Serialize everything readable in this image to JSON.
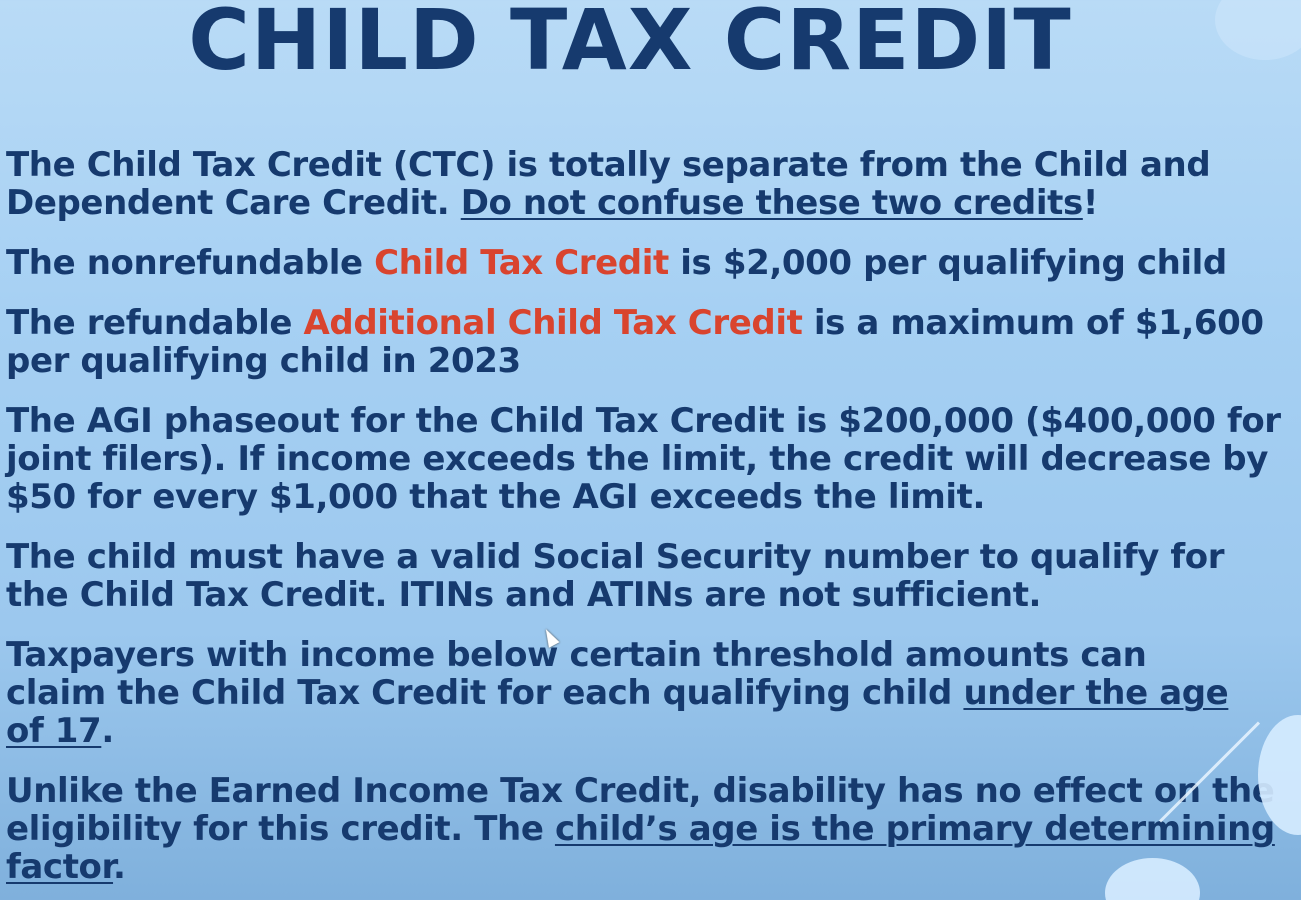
{
  "slide": {
    "title": "CHILD TAX CREDIT",
    "paragraphs": {
      "p1": {
        "a": "The Child Tax Credit (CTC) is totally separate from the Child and",
        "b": "Dependent Care Credit. ",
        "c": "Do not confuse these two credits",
        "d": "!"
      },
      "p2": {
        "a": "The nonrefundable ",
        "b": "Child Tax Credit",
        "c": " is $2,000 per qualifying child"
      },
      "p3": {
        "a": "The refundable ",
        "b": "Additional Child Tax Credit",
        "c": " is a maximum of $1,600",
        "d": "per qualifying child in 2023"
      },
      "p4": {
        "a": "The AGI phaseout for the Child Tax Credit is $200,000 ($400,000 for",
        "b": "joint filers). If income exceeds the limit, the credit will decrease by",
        "c": "$50 for every $1,000 that the AGI exceeds the limit."
      },
      "p5": {
        "a": "The child must have a valid Social Security number to qualify for",
        "b": "the Child Tax Credit. ITINs and ATINs are not sufficient."
      },
      "p6": {
        "a": "Taxpayers with income below certain threshold amounts can",
        "b": "claim the Child Tax Credit for each qualifying child ",
        "c": "under the age",
        "d": "of 17",
        "e": "."
      },
      "p7": {
        "a": "Unlike the Earned Income Tax Credit, disability has no effect on the",
        "b": "eligibility for this credit. The ",
        "c": "child’s age is the primary determining",
        "d": "factor",
        "e": "."
      }
    }
  },
  "colors": {
    "text": "#163a6e",
    "highlight": "#d9442e",
    "background": "#a6d0f3"
  },
  "icons": {
    "cursor": "mouse-pointer-icon"
  }
}
